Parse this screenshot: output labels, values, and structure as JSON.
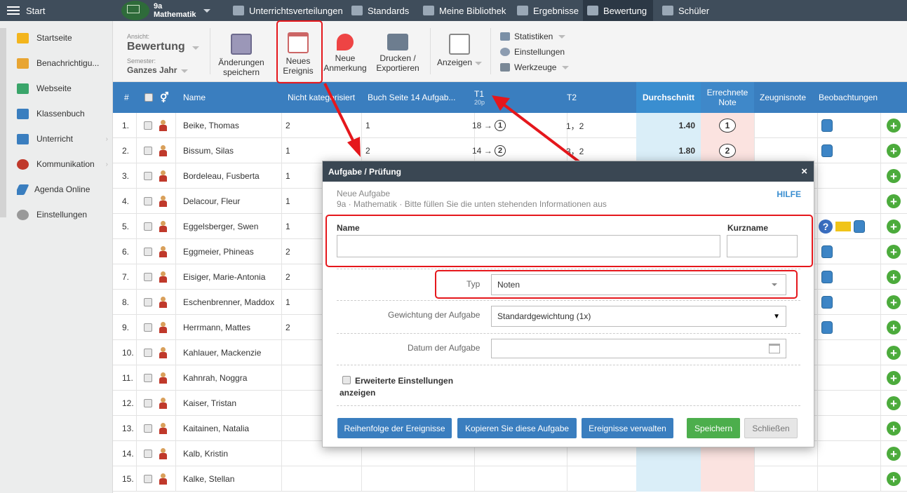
{
  "topbar": {
    "start": "Start",
    "class_line1": "9a",
    "class_line2": "Mathematik",
    "nav": [
      {
        "label": "Unterrichtsverteilungen",
        "icon": "briefcase-icon"
      },
      {
        "label": "Standards",
        "icon": "shield-icon"
      },
      {
        "label": "Meine Bibliothek",
        "icon": "library-icon"
      },
      {
        "label": "Ergebnisse",
        "icon": "bar-chart-icon"
      },
      {
        "label": "Bewertung",
        "icon": "gauge-icon"
      },
      {
        "label": "Schüler",
        "icon": "students-icon"
      }
    ]
  },
  "sidebar": {
    "items": [
      {
        "label": "Startseite",
        "icon": "star-icon",
        "color": "#f3b51d"
      },
      {
        "label": "Benachrichtigu...",
        "icon": "envelope-icon",
        "color": "#e8a532"
      },
      {
        "label": "Webseite",
        "icon": "house-icon",
        "color": "#3aa56a"
      },
      {
        "label": "Klassenbuch",
        "icon": "book-icon",
        "color": "#3a7ebf"
      },
      {
        "label": "Unterricht",
        "icon": "open-book-icon",
        "color": "#3a7ebf"
      },
      {
        "label": "Kommunikation",
        "icon": "chat-icon",
        "color": "#c0392b"
      },
      {
        "label": "Agenda Online",
        "icon": "pen-icon",
        "color": "#3a7ebf"
      },
      {
        "label": "Einstellungen",
        "icon": "gear-icon",
        "color": "#999999"
      }
    ]
  },
  "toolbar": {
    "ansicht_label": "Ansicht:",
    "ansicht_value": "Bewertung",
    "semester_label": "Semester:",
    "semester_value": "Ganzes Jahr",
    "save_1": "Änderungen",
    "save_2": "speichern",
    "new_event_1": "Neues",
    "new_event_2": "Ereignis",
    "new_note_1": "Neue",
    "new_note_2": "Anmerkung",
    "print_1": "Drucken /",
    "print_2": "Exportieren",
    "show": "Anzeigen",
    "links": [
      "Statistiken",
      "Einstellungen",
      "Werkzeuge"
    ]
  },
  "grid": {
    "headers": {
      "num": "#",
      "name": "Name",
      "nk": "Nicht kategorisiert",
      "buch": "Buch Seite 14 Aufgab...",
      "t1": "T1",
      "t1_sub": "20p",
      "t2": "T2",
      "avg": "Durchschnitt",
      "calc1": "Errechnete",
      "calc2": "Note",
      "zeugnis": "Zeugnisnote",
      "beob": "Beobachtungen"
    },
    "rows": [
      {
        "num": "1.",
        "name": "Beike, Thomas",
        "nk": "2",
        "buch": "1",
        "t1_score": "18",
        "t1_grade": "1",
        "t2": "1，2",
        "avg": "1.40",
        "calc": "1",
        "bag": true
      },
      {
        "num": "2.",
        "name": "Bissum, Silas",
        "nk": "1",
        "buch": "2",
        "t1_score": "14",
        "t1_grade": "2",
        "t2": "3，2",
        "avg": "1.80",
        "calc": "2",
        "bag": true
      },
      {
        "num": "3.",
        "name": "Bordeleau, Fusberta",
        "nk": "1"
      },
      {
        "num": "4.",
        "name": "Delacour, Fleur",
        "nk": "1"
      },
      {
        "num": "5.",
        "name": "Eggelsberger, Swen",
        "nk": "1",
        "extra": true,
        "bag": true
      },
      {
        "num": "6.",
        "name": "Eggmeier, Phineas",
        "nk": "2",
        "bag": true
      },
      {
        "num": "7.",
        "name": "Eisiger, Marie-Antonia",
        "nk": "2",
        "bag": true
      },
      {
        "num": "8.",
        "name": "Eschenbrenner, Maddox",
        "nk": "1",
        "bag": true
      },
      {
        "num": "9.",
        "name": "Herrmann, Mattes",
        "nk": "2",
        "bag": true
      },
      {
        "num": "10.",
        "name": "Kahlauer, Mackenzie"
      },
      {
        "num": "11.",
        "name": "Kahnrah, Noggra"
      },
      {
        "num": "12.",
        "name": "Kaiser, Tristan"
      },
      {
        "num": "13.",
        "name": "Kaitainen, Natalia"
      },
      {
        "num": "14.",
        "name": "Kalb, Kristin"
      },
      {
        "num": "15.",
        "name": "Kalke, Stellan"
      }
    ]
  },
  "modal": {
    "title": "Aufgabe / Prüfung",
    "close": "×",
    "subtitle": "Neue Aufgabe",
    "info": "9a · Mathematik · Bitte füllen Sie die unten stehenden Informationen aus",
    "help": "HILFE",
    "name_label": "Name",
    "short_label": "Kurzname",
    "typ_label": "Typ",
    "typ_value": "Noten",
    "weight_label": "Gewichtung der Aufgabe",
    "weight_value": "Standardgewichtung (1x)",
    "date_label": "Datum der Aufgabe",
    "adv_1": "Erweiterte Einstellungen",
    "adv_2": "anzeigen",
    "btn_order": "Reihenfolge der Ereignisse",
    "btn_copy": "Kopieren Sie diese Aufgabe",
    "btn_manage": "Ereignisse verwalten",
    "btn_save": "Speichern",
    "btn_close": "Schließen"
  },
  "colors": {
    "topbar": "#3f4d5b",
    "grid_header": "#3a7ebf",
    "avg_col": "#daeef8",
    "calc_col": "#fbe3e0",
    "highlight": "#e5171c",
    "save": "#4cae4c",
    "blue_btn": "#3a7ebf"
  }
}
